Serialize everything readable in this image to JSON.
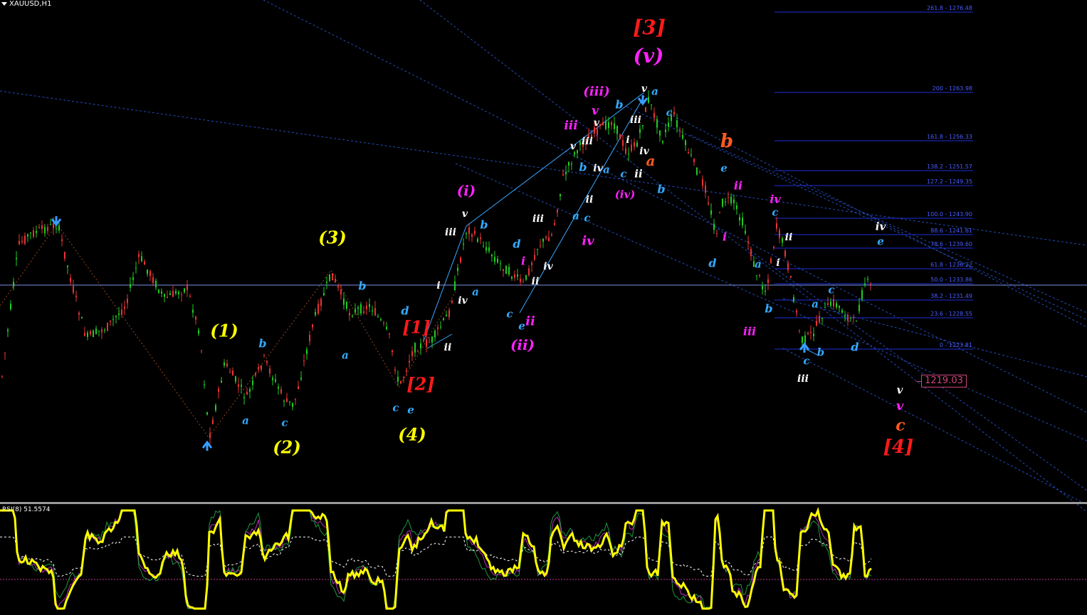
{
  "symbol_title": "XAUUSD,H1",
  "rsi_title": "RSI(8) 51.5574",
  "price_label": "1219.03",
  "colors": {
    "background": "#000000",
    "bull_candle": "#22cc22",
    "bear_candle": "#e83434",
    "wave_primary": "#ff1a1a",
    "wave_intermediate": "#ffff00",
    "wave_minor": "#ff22ff",
    "wave_minute": "#33aaff",
    "wave_minuette": "#ffffff",
    "wave_orange": "#ff5a1f",
    "rsi_line": "#ffff00",
    "fib_line": "#1c2fd8",
    "channel": "#2b59d8"
  },
  "fib_levels": [
    "261.8 - 1276.48",
    "200 - 1263.98",
    "161.8 - 1256.33",
    "138.2 - 1251.57",
    "127.2 - 1249.35",
    "100.0 - 1243.90",
    "88.6 - 1241.61",
    "78.6 - 1239.60",
    "61.8 - 1236.22",
    "50.0 - 1233.86",
    "38.2 - 1231.49",
    "23.6 - 1228.55",
    "0 - 1223.81"
  ],
  "wave_labels": [
    {
      "t": "[3]",
      "c": "wave_primary",
      "s": 28,
      "w": "bold",
      "i": true
    },
    {
      "t": "(v)",
      "c": "wave_minor",
      "s": 28,
      "w": "bold",
      "i": true
    },
    {
      "t": "(iii)",
      "c": "wave_minor",
      "s": 18,
      "w": "bold",
      "i": true
    },
    {
      "t": "v",
      "c": "wave_minor",
      "s": 17,
      "w": "bold",
      "i": true
    },
    {
      "t": "iii",
      "c": "wave_minor",
      "s": 17,
      "w": "bold",
      "i": true
    },
    {
      "t": "v",
      "c": "wave_minuette",
      "s": 14,
      "w": "bold",
      "i": true
    },
    {
      "t": "a",
      "c": "wave_minute",
      "s": 15,
      "w": "bold",
      "i": true
    },
    {
      "t": "b",
      "c": "wave_minute",
      "s": 16,
      "w": "bold",
      "i": true
    },
    {
      "t": "v",
      "c": "wave_minuette",
      "s": 14,
      "w": "bold",
      "i": true
    },
    {
      "t": "iii",
      "c": "wave_minuette",
      "s": 14,
      "w": "bold",
      "i": true
    },
    {
      "t": "iii",
      "c": "wave_minuette",
      "s": 14,
      "w": "bold",
      "i": true
    },
    {
      "t": "c",
      "c": "wave_minute",
      "s": 14,
      "w": "bold",
      "i": true
    },
    {
      "t": "i",
      "c": "wave_minuette",
      "s": 14,
      "w": "bold",
      "i": true
    },
    {
      "t": "v",
      "c": "wave_minuette",
      "s": 14,
      "w": "bold",
      "i": true
    },
    {
      "t": "iv",
      "c": "wave_minuette",
      "s": 14,
      "w": "bold",
      "i": true
    },
    {
      "t": "b",
      "c": "wave_minute",
      "s": 16,
      "w": "bold",
      "i": true
    },
    {
      "t": "iv",
      "c": "wave_minuette",
      "s": 14,
      "w": "bold",
      "i": true
    },
    {
      "t": "a",
      "c": "wave_minute",
      "s": 15,
      "w": "bold",
      "i": true
    },
    {
      "t": "c",
      "c": "wave_minute",
      "s": 15,
      "w": "bold",
      "i": true
    },
    {
      "t": "ii",
      "c": "wave_minuette",
      "s": 15,
      "w": "bold",
      "i": true
    },
    {
      "t": "a",
      "c": "wave_orange",
      "s": 20,
      "w": "bold",
      "i": true
    },
    {
      "t": "(iv)",
      "c": "wave_minor",
      "s": 15,
      "w": "bold",
      "i": true
    },
    {
      "t": "b",
      "c": "wave_minute",
      "s": 16,
      "w": "bold",
      "i": true
    },
    {
      "t": "ii",
      "c": "wave_minuette",
      "s": 14,
      "w": "bold",
      "i": true
    },
    {
      "t": "a",
      "c": "wave_minute",
      "s": 15,
      "w": "bold",
      "i": true
    },
    {
      "t": "c",
      "c": "wave_minute",
      "s": 15,
      "w": "bold",
      "i": true
    },
    {
      "t": "iv",
      "c": "wave_minor",
      "s": 18,
      "w": "bold",
      "i": true
    },
    {
      "t": "b",
      "c": "wave_orange",
      "s": 26,
      "w": "bold",
      "i": true
    },
    {
      "t": "e",
      "c": "wave_minute",
      "s": 15,
      "w": "bold",
      "i": true
    },
    {
      "t": "ii",
      "c": "wave_minor",
      "s": 16,
      "w": "bold",
      "i": true
    },
    {
      "t": "iv",
      "c": "wave_minor",
      "s": 16,
      "w": "bold",
      "i": true
    },
    {
      "t": "c",
      "c": "wave_minute",
      "s": 15,
      "w": "bold",
      "i": true
    },
    {
      "t": "ii",
      "c": "wave_minuette",
      "s": 14,
      "w": "bold",
      "i": true
    },
    {
      "t": "i",
      "c": "wave_minor",
      "s": 16,
      "w": "bold",
      "i": true
    },
    {
      "t": "d",
      "c": "wave_minute",
      "s": 16,
      "w": "bold",
      "i": true
    },
    {
      "t": "a",
      "c": "wave_minute",
      "s": 15,
      "w": "bold",
      "i": true
    },
    {
      "t": "i",
      "c": "wave_minuette",
      "s": 14,
      "w": "bold",
      "i": true
    },
    {
      "t": "b",
      "c": "wave_minute",
      "s": 16,
      "w": "bold",
      "i": true
    },
    {
      "t": "iii",
      "c": "wave_minor",
      "s": 16,
      "w": "bold",
      "i": true
    },
    {
      "t": "c",
      "c": "wave_minute",
      "s": 15,
      "w": "bold",
      "i": true
    },
    {
      "t": "b",
      "c": "wave_minute",
      "s": 15,
      "w": "bold",
      "i": true
    },
    {
      "t": "iii",
      "c": "wave_minuette",
      "s": 14,
      "w": "bold",
      "i": true
    },
    {
      "t": "a",
      "c": "wave_minute",
      "s": 15,
      "w": "bold",
      "i": true
    },
    {
      "t": "c",
      "c": "wave_minute",
      "s": 15,
      "w": "bold",
      "i": true
    },
    {
      "t": "d",
      "c": "wave_minute",
      "s": 16,
      "w": "bold",
      "i": true
    },
    {
      "t": "iv",
      "c": "wave_minuette",
      "s": 15,
      "w": "bold",
      "i": true
    },
    {
      "t": "e",
      "c": "wave_minute",
      "s": 15,
      "w": "bold",
      "i": true
    },
    {
      "t": "v",
      "c": "wave_minuette",
      "s": 15,
      "w": "bold",
      "i": true
    },
    {
      "t": "v",
      "c": "wave_minor",
      "s": 18,
      "w": "bold",
      "i": true
    },
    {
      "t": "c",
      "c": "wave_orange",
      "s": 22,
      "w": "bold",
      "i": true
    },
    {
      "t": "[4]",
      "c": "wave_primary",
      "s": 26,
      "w": "bold",
      "i": true
    },
    {
      "t": "(i)",
      "c": "wave_minor",
      "s": 20,
      "w": "bold",
      "i": true
    },
    {
      "t": "v",
      "c": "wave_minuette",
      "s": 14,
      "w": "bold",
      "i": true
    },
    {
      "t": "iii",
      "c": "wave_minuette",
      "s": 14,
      "w": "bold",
      "i": true
    },
    {
      "t": "b",
      "c": "wave_minute",
      "s": 16,
      "w": "bold",
      "i": true
    },
    {
      "t": "d",
      "c": "wave_minute",
      "s": 16,
      "w": "bold",
      "i": true
    },
    {
      "t": "iii",
      "c": "wave_minuette",
      "s": 14,
      "w": "bold",
      "i": true
    },
    {
      "t": "i",
      "c": "wave_minor",
      "s": 16,
      "w": "bold",
      "i": true
    },
    {
      "t": "iv",
      "c": "wave_minuette",
      "s": 14,
      "w": "bold",
      "i": true
    },
    {
      "t": "a",
      "c": "wave_minute",
      "s": 15,
      "w": "bold",
      "i": true
    },
    {
      "t": "iv",
      "c": "wave_minuette",
      "s": 14,
      "w": "bold",
      "i": true
    },
    {
      "t": "ii",
      "c": "wave_minuette",
      "s": 14,
      "w": "bold",
      "i": true
    },
    {
      "t": "c",
      "c": "wave_minute",
      "s": 15,
      "w": "bold",
      "i": true
    },
    {
      "t": "e",
      "c": "wave_minute",
      "s": 15,
      "w": "bold",
      "i": true
    },
    {
      "t": "ii",
      "c": "wave_minor",
      "s": 18,
      "w": "bold",
      "i": true
    },
    {
      "t": "(ii)",
      "c": "wave_minor",
      "s": 20,
      "w": "bold",
      "i": true
    },
    {
      "t": "i",
      "c": "wave_minuette",
      "s": 14,
      "w": "bold",
      "i": true
    },
    {
      "t": "ii",
      "c": "wave_minuette",
      "s": 14,
      "w": "bold",
      "i": true
    },
    {
      "t": "d",
      "c": "wave_minute",
      "s": 16,
      "w": "bold",
      "i": true
    },
    {
      "t": "[1]",
      "c": "wave_primary",
      "s": 24,
      "w": "bold",
      "i": true
    },
    {
      "t": "[2]",
      "c": "wave_primary",
      "s": 24,
      "w": "bold",
      "i": true
    },
    {
      "t": "c",
      "c": "wave_minute",
      "s": 15,
      "w": "bold",
      "i": true
    },
    {
      "t": "e",
      "c": "wave_minute",
      "s": 15,
      "w": "bold",
      "i": true
    },
    {
      "t": "(4)",
      "c": "wave_intermediate",
      "s": 24,
      "w": "bold",
      "i": true
    },
    {
      "t": "(3)",
      "c": "wave_intermediate",
      "s": 24,
      "w": "bold",
      "i": true
    },
    {
      "t": "b",
      "c": "wave_minute",
      "s": 16,
      "w": "bold",
      "i": true
    },
    {
      "t": "a",
      "c": "wave_minute",
      "s": 15,
      "w": "bold",
      "i": true
    },
    {
      "t": "(1)",
      "c": "wave_intermediate",
      "s": 24,
      "w": "bold",
      "i": true
    },
    {
      "t": "b",
      "c": "wave_minute",
      "s": 16,
      "w": "bold",
      "i": true
    },
    {
      "t": "a",
      "c": "wave_minute",
      "s": 15,
      "w": "bold",
      "i": true
    },
    {
      "t": "c",
      "c": "wave_minute",
      "s": 15,
      "w": "bold",
      "i": true
    },
    {
      "t": "(2)",
      "c": "wave_intermediate",
      "s": 24,
      "w": "bold",
      "i": true
    }
  ],
  "chart_data": {
    "type": "candlestick",
    "symbol": "XAUUSD",
    "timeframe": "H1",
    "current_price": 1219.03,
    "horizontal_level": 1233.86,
    "fib_levels": [
      1276.48,
      1263.98,
      1256.33,
      1251.57,
      1249.35,
      1243.9,
      1241.61,
      1239.6,
      1236.22,
      1233.86,
      1231.49,
      1228.55,
      1223.81
    ],
    "rsi": {
      "period": 8,
      "value": 51.5574
    }
  }
}
